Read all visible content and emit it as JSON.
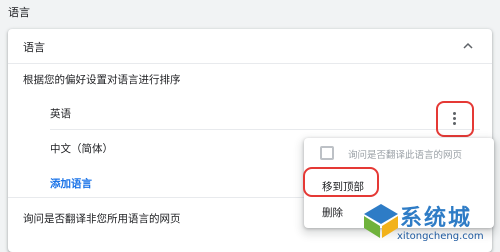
{
  "section_title": "语言",
  "card": {
    "title": "语言",
    "subtitle": "根据您的偏好设置对语言进行排序",
    "languages": [
      {
        "name": "英语"
      },
      {
        "name": "中文（简体）"
      }
    ],
    "add_language_label": "添加语言",
    "ask_translate_label": "询问是否翻译非您所用语言的网页"
  },
  "context_menu": {
    "checkbox_label": "询问是否翻译此语言的网页",
    "checkbox_checked": false,
    "move_to_top_label": "移到顶部",
    "delete_label": "删除"
  },
  "watermark": {
    "brand": "系统城",
    "url": "xitongcheng.com"
  },
  "colors": {
    "link": "#1a73e8",
    "highlight": "#e53935",
    "watermark": "#2e7cc6"
  }
}
